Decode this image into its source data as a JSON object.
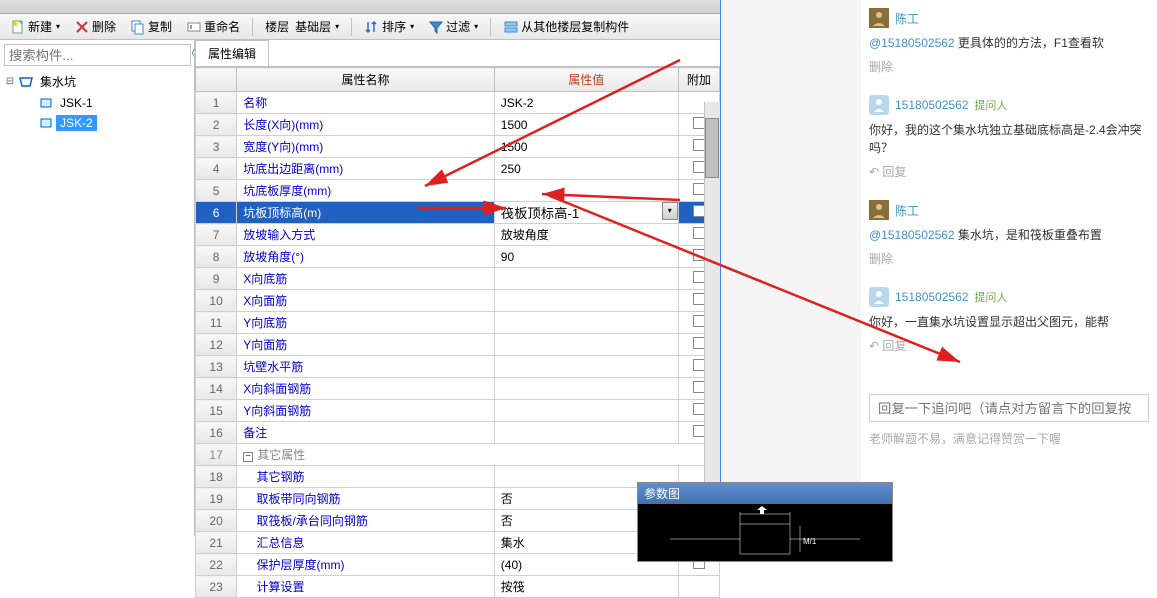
{
  "toolbar": {
    "new_label": "新建",
    "delete_label": "删除",
    "copy_label": "复制",
    "rename_label": "重命名",
    "floor_label": "楼层",
    "floor_value": "基础层",
    "sort_label": "排序",
    "filter_label": "过滤",
    "copy_from_other_label": "从其他楼层复制构件"
  },
  "search": {
    "placeholder": "搜索构件..."
  },
  "tree": {
    "root": "集水坑",
    "children": [
      "JSK-1",
      "JSK-2"
    ],
    "selected": "JSK-2"
  },
  "tab": {
    "prop_edit": "属性编辑"
  },
  "table": {
    "col_name": "属性名称",
    "col_value": "属性值",
    "col_extra": "附加",
    "rows": [
      {
        "i": 1,
        "name": "名称",
        "value": "JSK-2",
        "extra": null
      },
      {
        "i": 2,
        "name": "长度(X向)(mm)",
        "value": "1500",
        "extra": false
      },
      {
        "i": 3,
        "name": "宽度(Y向)(mm)",
        "value": "1500",
        "extra": false
      },
      {
        "i": 4,
        "name": "坑底出边距离(mm)",
        "value": "250",
        "extra": false
      },
      {
        "i": 5,
        "name": "坑底板厚度(mm)",
        "value": "",
        "extra": false
      },
      {
        "i": 6,
        "name": "坑板顶标高(m)",
        "value": "筏板顶标高-1",
        "extra": false,
        "selected": true,
        "editing": true
      },
      {
        "i": 7,
        "name": "放坡输入方式",
        "value": "放坡角度",
        "extra": false
      },
      {
        "i": 8,
        "name": "放坡角度(°)",
        "value": "90",
        "extra": false
      },
      {
        "i": 9,
        "name": "X向底筋",
        "value": "",
        "extra": false
      },
      {
        "i": 10,
        "name": "X向面筋",
        "value": "",
        "extra": false
      },
      {
        "i": 11,
        "name": "Y向底筋",
        "value": "",
        "extra": false
      },
      {
        "i": 12,
        "name": "Y向面筋",
        "value": "",
        "extra": false
      },
      {
        "i": 13,
        "name": "坑壁水平筋",
        "value": "",
        "extra": false
      },
      {
        "i": 14,
        "name": "X向斜面钢筋",
        "value": "",
        "extra": false
      },
      {
        "i": 15,
        "name": "Y向斜面钢筋",
        "value": "",
        "extra": false
      },
      {
        "i": 16,
        "name": "备注",
        "value": "",
        "extra": false
      },
      {
        "i": 17,
        "name": "其它属性",
        "category": true
      },
      {
        "i": 18,
        "name": "其它钢筋",
        "value": "",
        "extra": null,
        "indent": true
      },
      {
        "i": 19,
        "name": "取板带同向钢筋",
        "value": "否",
        "extra": false,
        "indent": true
      },
      {
        "i": 20,
        "name": "取筏板/承台同向钢筋",
        "value": "否",
        "extra": false,
        "indent": true
      },
      {
        "i": 21,
        "name": "汇总信息",
        "value": "集水",
        "extra": false,
        "indent": true
      },
      {
        "i": 22,
        "name": "保护层厚度(mm)",
        "value": "(40)",
        "extra": false,
        "indent": true
      },
      {
        "i": 23,
        "name": "计算设置",
        "value": "按筏",
        "extra": null,
        "indent": true
      }
    ]
  },
  "preview": {
    "title": "参数图"
  },
  "chat": {
    "items": [
      {
        "avatar_type": "photo",
        "name": "陈工",
        "tag": null,
        "body_prefix": "@15180502562",
        "body": " 更具体的的方法，F1查看软",
        "actions": [
          "删除"
        ]
      },
      {
        "avatar_type": "anon",
        "name": "15180502562",
        "tag": "提问人",
        "body_prefix": "",
        "body": "你好，我的这个集水坑独立基础底标高是-2.4会冲突吗？",
        "actions": [
          "回复"
        ]
      },
      {
        "avatar_type": "photo",
        "name": "陈工",
        "tag": null,
        "body_prefix": "@15180502562",
        "body": " 集水坑，是和筏板重叠布置",
        "actions": [
          "删除"
        ]
      },
      {
        "avatar_type": "anon",
        "name": "15180502562",
        "tag": "提问人",
        "body_prefix": "",
        "body": "你好，一直集水坑设置显示超出父图元，能帮",
        "actions": [
          "回复"
        ]
      }
    ],
    "reply_placeholder": "回复一下追问吧（请点对方留言下的回复按",
    "bottom_hint": "老师解题不易，满意记得赞赏一下喔"
  }
}
